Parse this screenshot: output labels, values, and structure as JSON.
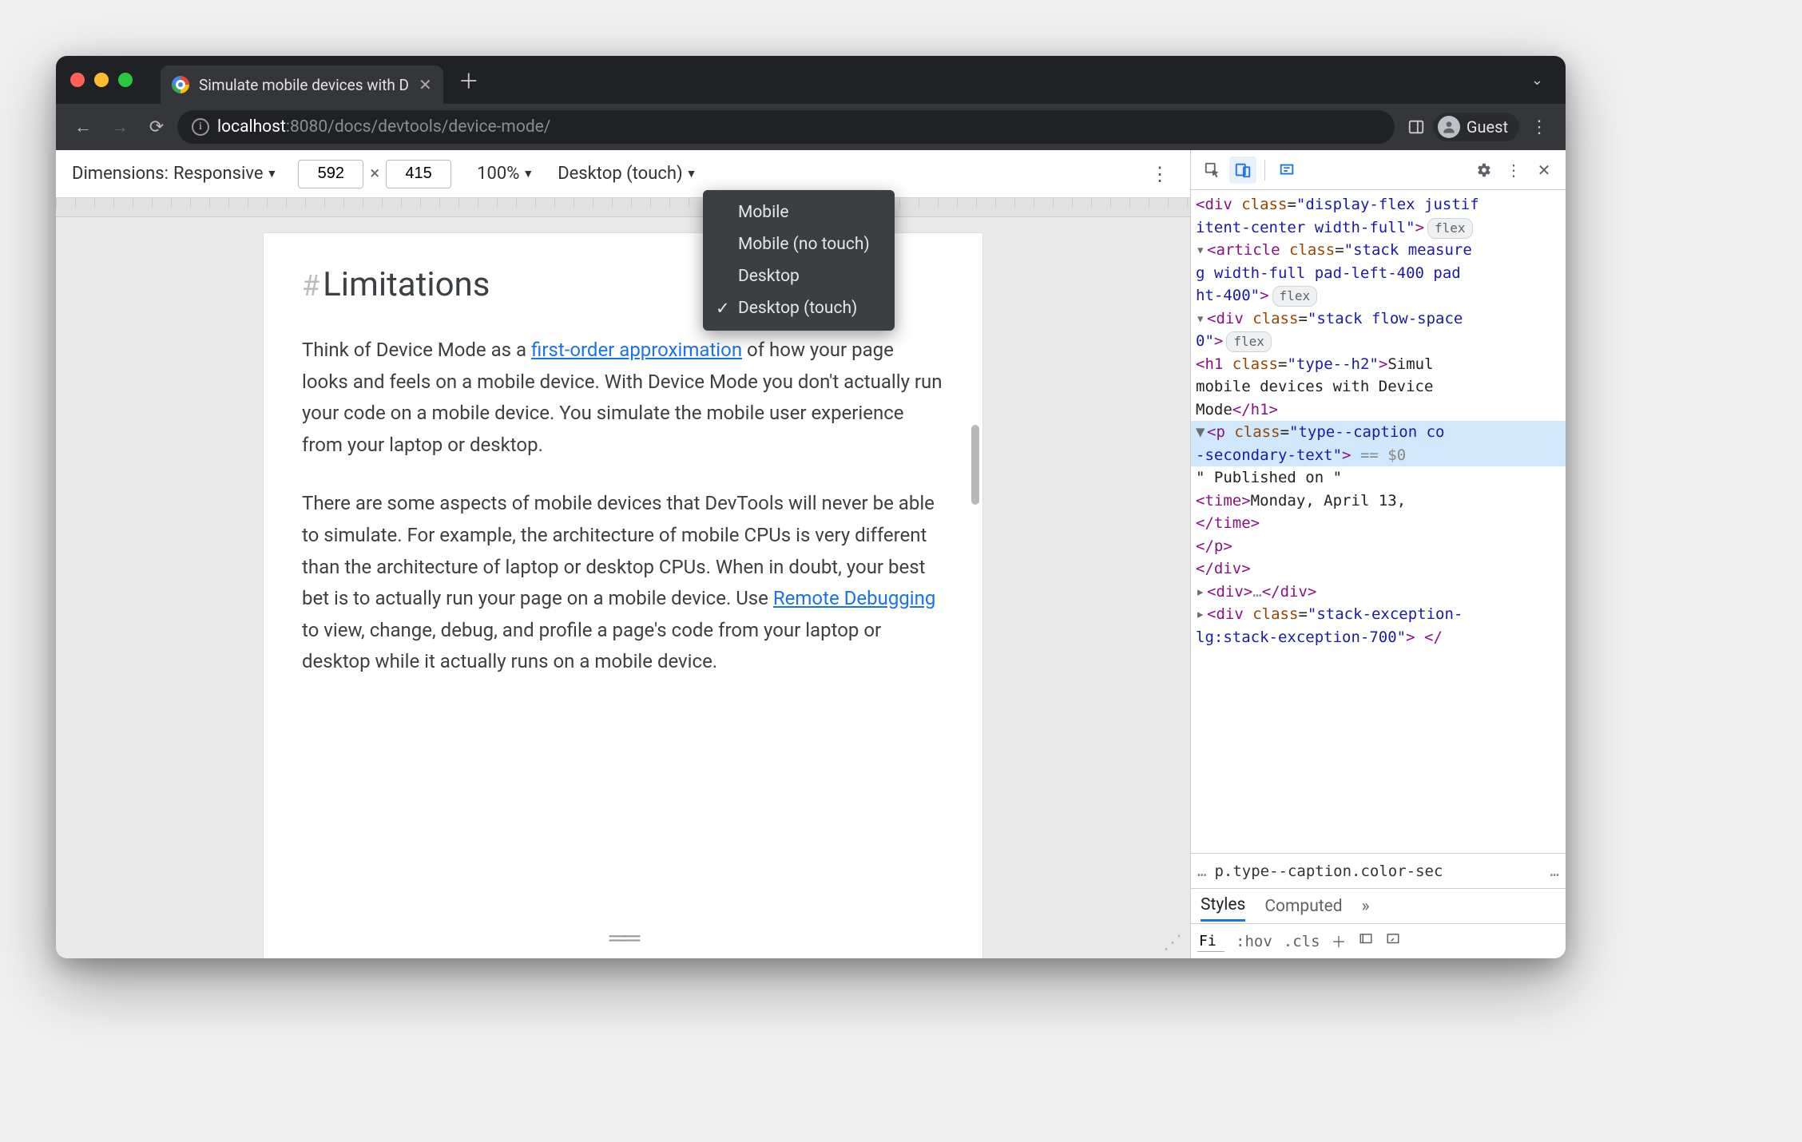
{
  "browser": {
    "tab_title": "Simulate mobile devices with D",
    "guest_label": "Guest",
    "url_host": "localhost",
    "url_port": ":8080",
    "url_path": "/docs/devtools/device-mode/"
  },
  "device_toolbar": {
    "dimensions_label": "Dimensions:",
    "dimensions_mode": "Responsive",
    "width": "592",
    "height": "415",
    "zoom": "100%",
    "device_type": "Desktop (touch)",
    "dropdown": {
      "items": [
        "Mobile",
        "Mobile (no touch)",
        "Desktop",
        "Desktop (touch)"
      ],
      "selected_index": 3
    }
  },
  "page": {
    "heading": "Limitations",
    "p1_a": "Think of Device Mode as a ",
    "p1_link1": "first-order approximation",
    "p1_b": " of how your page looks and feels on a mobile device. With Device Mode you don't actually run your code on a mobile device. You simulate the mobile user experience from your laptop or desktop.",
    "p2_a": "There are some aspects of mobile devices that DevTools will never be able to simulate. For example, the architecture of mobile CPUs is very different than the architecture of laptop or desktop CPUs. When in doubt, your best bet is to actually run your page on a mobile device. Use ",
    "p2_link": "Remote Debugging",
    "p2_b": " to view, change, debug, and profile a page's code from your laptop or desktop while it actually runs on a mobile device."
  },
  "devtools": {
    "breadcrumb": "p.type--caption.color-sec",
    "styles_tabs": {
      "styles": "Styles",
      "computed": "Computed"
    },
    "styles_bar": {
      "filter": "Fi",
      "hov": ":hov",
      "cls": ".cls"
    },
    "dom": {
      "l1_a": "div",
      "l1_class": "display-flex justif",
      "l2": "itent-center width-full",
      "l3_a": "article",
      "l3_class": "stack measure",
      "l4": "g width-full pad-left-400 pad",
      "l5": "ht-400",
      "l6_a": "div",
      "l6_class": "stack flow-space",
      "l7": "0",
      "l8_a": "h1",
      "l8_class": "type--h2",
      "l8_txt": "Simul",
      "l9": "mobile devices with Device",
      "l10_txt": "Mode",
      "l10_close": "h1",
      "l11_a": "p",
      "l11_class": "type--caption co",
      "l12": "-secondary-text",
      "l12_eq": " == $0",
      "l13": "\" Published on \"",
      "l14_a": "time",
      "l14_txt": "Monday, April 13,",
      "l15": "time",
      "l16": "p",
      "l17": "div",
      "l18_a": "div",
      "l18_mid": "…",
      "l18_b": "div",
      "l19_a": "div",
      "l19_class": "stack-exception-",
      "l20": "lg:stack-exception-700"
    }
  }
}
